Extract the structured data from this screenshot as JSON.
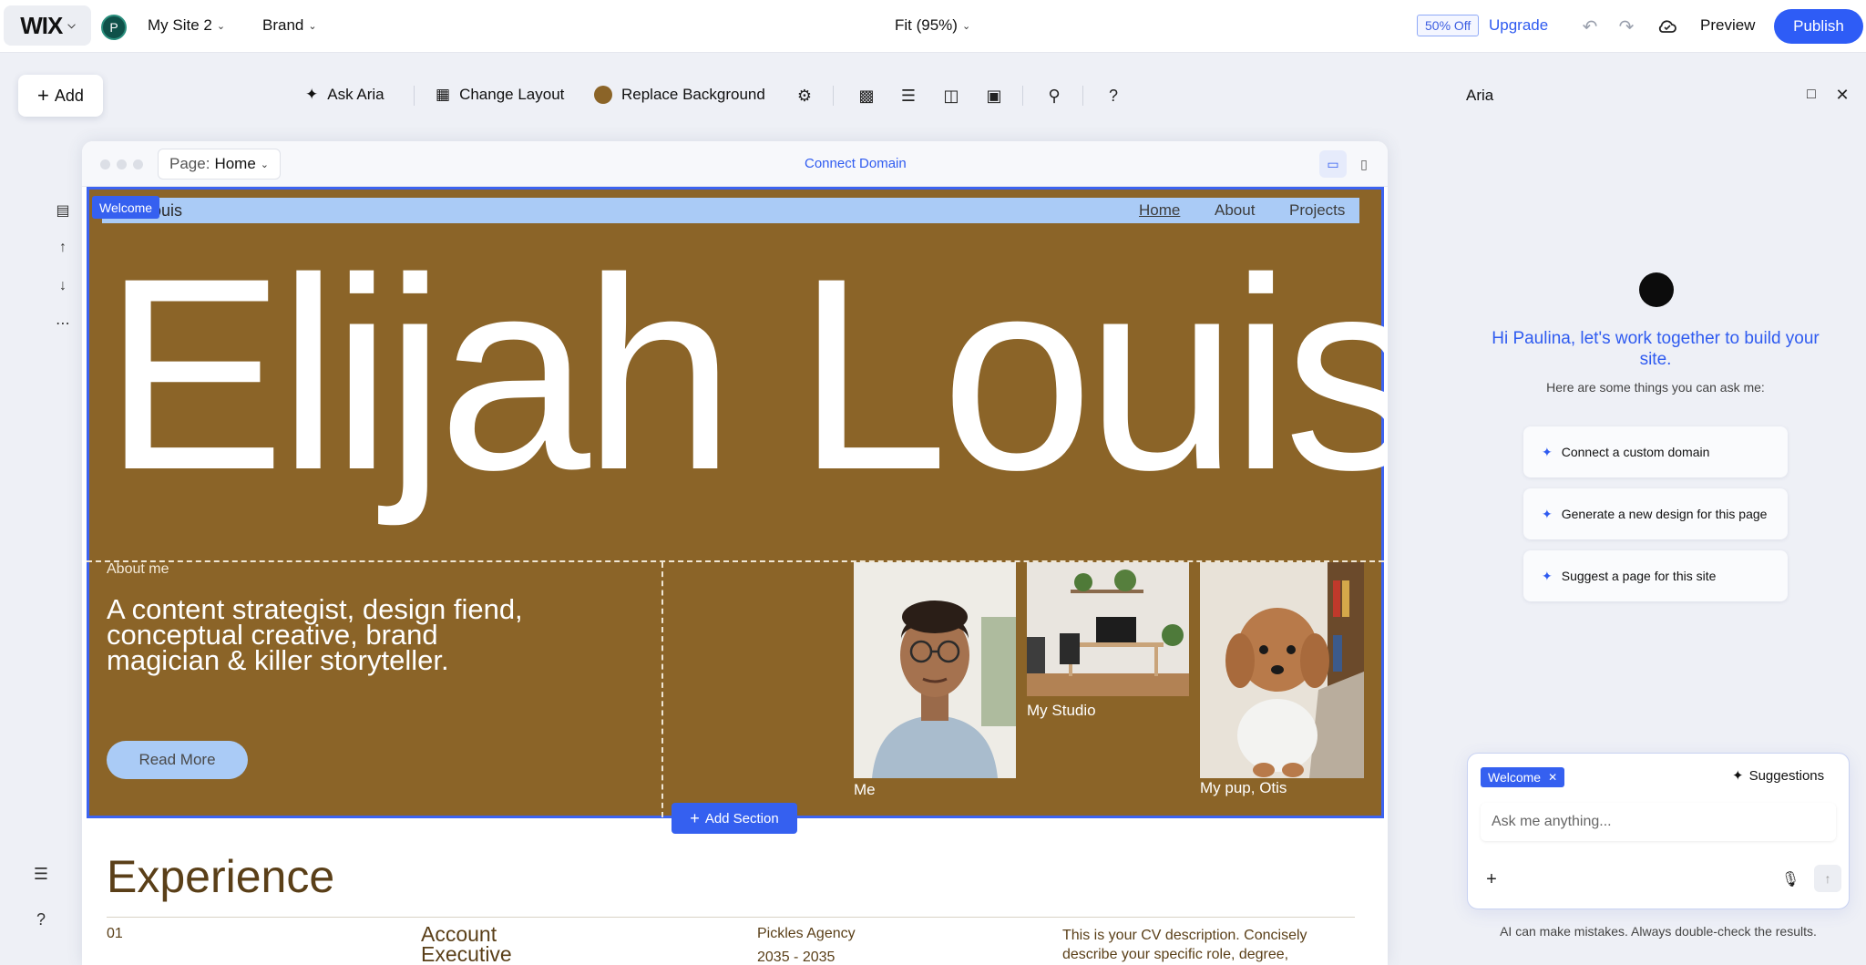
{
  "topbar": {
    "logo": "WIX",
    "avatar_initial": "P",
    "site_name": "My Site 2",
    "brand": "Brand",
    "zoom": "Fit (95%)",
    "discount_badge": "50% Off",
    "upgrade": "Upgrade",
    "preview": "Preview",
    "publish": "Publish"
  },
  "toolbar": {
    "add": "Add",
    "ask_aria": "Ask Aria",
    "change_layout": "Change Layout",
    "replace_background": "Replace Background",
    "help": "?"
  },
  "frame": {
    "page_prefix": "Page:",
    "page_name": "Home",
    "connect_domain": "Connect Domain"
  },
  "site": {
    "section_tag": "Welcome",
    "nav_name": "ouis",
    "nav_links": [
      "Home",
      "About",
      "Projects"
    ],
    "hero_name": "Elijah Louis",
    "about_label": "About me",
    "about_text": "A content strategist, design fiend, conceptual creative, brand magician & killer storyteller.",
    "read_more": "Read More",
    "captions": [
      "Me",
      "My Studio",
      "My pup, Otis"
    ],
    "add_section": "Add Section",
    "experience_title": "Experience",
    "experience_row": {
      "number": "01",
      "role": "Account Executive",
      "company": "Pickles Agency",
      "years": "2035 - 2035",
      "description": "This is your CV description. Concisely describe your specific role, degree,"
    }
  },
  "aria": {
    "title": "Aria",
    "greeting": "Hi Paulina, let's work together to build your site.",
    "subtitle": "Here are some things you can ask me:",
    "suggestions": [
      "Connect a custom domain",
      "Generate a new design for this page",
      "Suggest a page for this site"
    ],
    "chip": "Welcome",
    "suggestions_button": "Suggestions",
    "input_placeholder": "Ask me anything...",
    "disclaimer": "AI can make mistakes. Always double-check the results."
  },
  "colors": {
    "accent": "#2e5cf6",
    "hero_bg": "#8b6428",
    "nav_strip": "#aacbf6"
  }
}
